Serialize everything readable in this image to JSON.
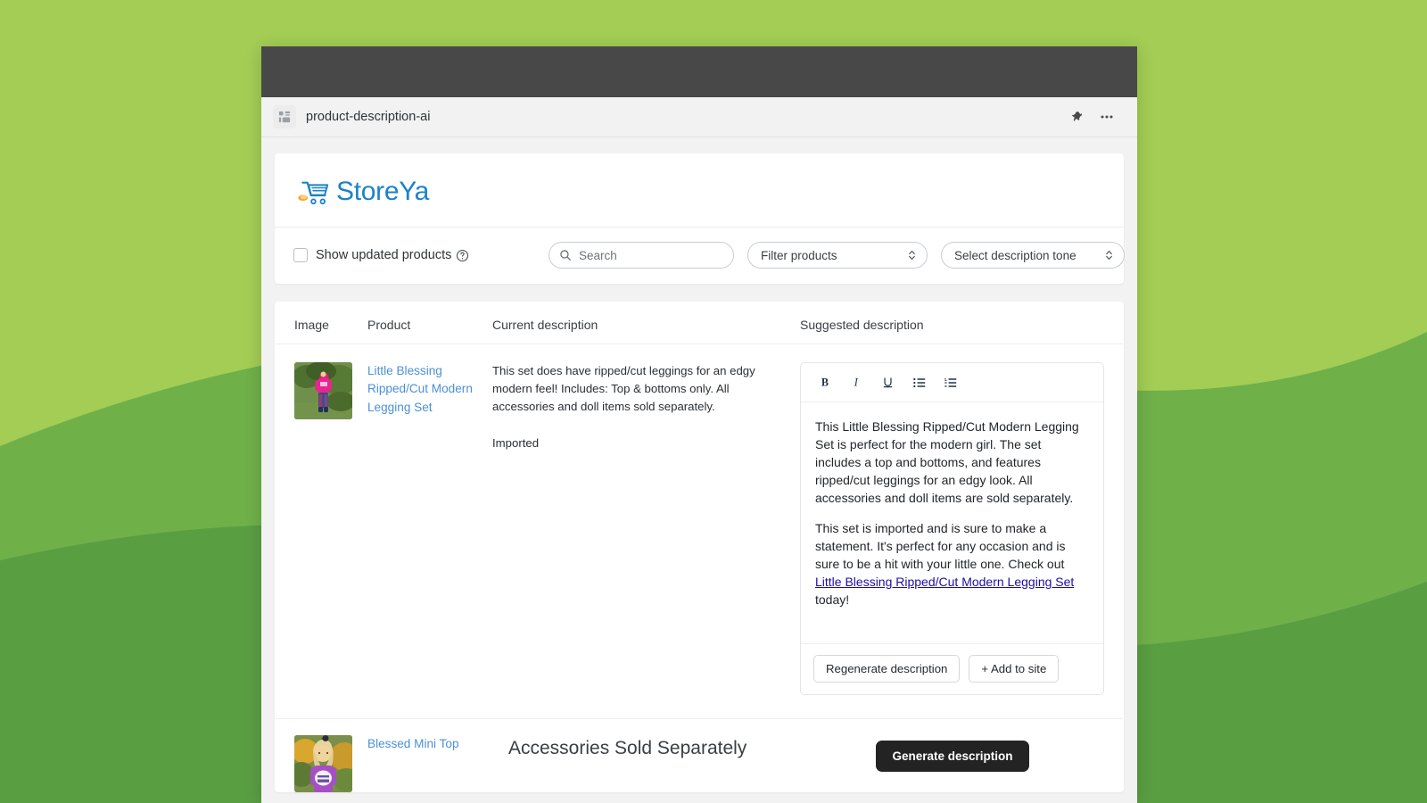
{
  "browser": {
    "tab_title": "product-description-ai",
    "favicon_icon": "extension-puzzle-icon",
    "pin_icon": "pin-icon",
    "more_icon": "more-horizontal-icon"
  },
  "brand": {
    "name": "StoreYa",
    "logo_icon": "shopping-cart-icon",
    "color": "#1c82c8",
    "accent_color": "#f0a41e"
  },
  "theme": {
    "background_green": "#a3cd54",
    "wave_mid_green": "#72b council",
    "wave_mid": "#6fb049",
    "wave_dark": "#5a9e42",
    "titlebar": "#484848",
    "link_blue": "#4a90d9",
    "editor_link": "#1a0dab"
  },
  "controls": {
    "show_updated_label": "Show updated products",
    "show_updated_checked": false,
    "help_icon": "question-mark-circle-icon",
    "search": {
      "placeholder": "Search",
      "value": "",
      "icon": "search-icon"
    },
    "filter_products": {
      "value": "Filter products",
      "icon": "chevron-up-down-icon"
    },
    "description_tone": {
      "value": "Select description tone",
      "icon": "chevron-up-down-icon"
    }
  },
  "table": {
    "columns": [
      {
        "key": "image",
        "label": "Image"
      },
      {
        "key": "product",
        "label": "Product"
      },
      {
        "key": "current",
        "label": "Current description"
      },
      {
        "key": "suggested",
        "label": "Suggested description"
      }
    ],
    "rows": [
      {
        "product_name": "Little Blessing Ripped/Cut Modern Legging Set",
        "image_alt": "girl-in-pink-top-and-patterned-leggings",
        "current_description": [
          "This set does have ripped/cut leggings for an edgy modern feel! Includes: Top & bottoms only. All accessories and doll items sold separately.",
          "Imported"
        ],
        "editor": {
          "toolbar": [
            {
              "name": "bold-icon",
              "label": "B"
            },
            {
              "name": "italic-icon",
              "label": "I"
            },
            {
              "name": "underline-icon",
              "label": "U"
            },
            {
              "name": "bullet-list-icon",
              "label": ""
            },
            {
              "name": "numbered-list-icon",
              "label": ""
            }
          ],
          "paragraph_1": "This Little Blessing Ripped/Cut Modern Legging Set is perfect for the modern girl. The set includes a top and bottoms, and features ripped/cut leggings for an edgy look. All accessories and doll items are sold separately.",
          "paragraph_2_before": "This set is imported and is sure to make a statement. It's perfect for any occasion and is sure to be a hit with your little one. Check out ",
          "paragraph_2_link": "Little Blessing Ripped/Cut Modern Legging Set",
          "paragraph_2_after": " today!",
          "regenerate_label": "Regenerate description",
          "add_to_site_label": "+ Add to site"
        }
      },
      {
        "product_name": "Blessed Mini Top",
        "image_alt": "girl-in-purple-blessed-mini-top",
        "current_description": [
          "Accessories Sold Separately"
        ],
        "generate_label": "Generate description"
      }
    ]
  }
}
